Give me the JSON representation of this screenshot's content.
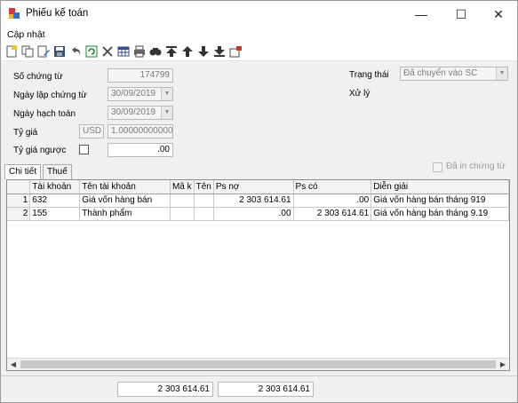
{
  "window": {
    "title": "Phiếu kế toán",
    "minimize": "—",
    "maximize": "☐",
    "close": "✕"
  },
  "menu": {
    "cap_nhat": "Cập nhật"
  },
  "toolbar": {
    "icons": [
      "new-icon",
      "copy-icon",
      "edit-icon",
      "save-icon",
      "undo-icon",
      "refresh-icon",
      "delete-icon",
      "table-icon",
      "print-icon",
      "find-icon",
      "first-icon",
      "prev-icon",
      "next-icon",
      "last-icon",
      "export-icon"
    ]
  },
  "form": {
    "so_chung_tu_label": "Số chứng từ",
    "so_chung_tu": "174799",
    "ngay_lap_label": "Ngày lập chứng từ",
    "ngay_lap": "30/09/2019",
    "ngay_hach_toan_label": "Ngày hạch toán",
    "ngay_hach_toan": "30/09/2019",
    "ty_gia_label": "Tỷ giá",
    "currency": "USD",
    "ty_gia": "1.000000000000",
    "ty_gia_nguoc_label": "Tỷ giá ngược",
    "ty_gia_nguoc": ".00",
    "trang_thai_label": "Trạng thái",
    "trang_thai": "Đã chuyển vào SC",
    "xu_ly_label": "Xử lý",
    "da_in_label": "Đã in chứng từ"
  },
  "tabs": [
    "Chi tiết",
    "Thuế"
  ],
  "grid": {
    "headers": [
      "Tài khoản",
      "Tên tài khoản",
      "Mã k",
      "Tên",
      "Ps nợ",
      "Ps có",
      "Diễn giải"
    ],
    "rows": [
      {
        "n": "1",
        "tk": "632",
        "ten": "Giá vốn hàng bán",
        "ma": "",
        "tenk": "",
        "no": "2 303 614.61",
        "co": ".00",
        "dg": "Giá vốn hàng bán tháng 919"
      },
      {
        "n": "2",
        "tk": "155",
        "ten": "Thành phẩm",
        "ma": "",
        "tenk": "",
        "no": ".00",
        "co": "2 303 614.61",
        "dg": "Giá vốn hàng bán tháng 9.19"
      }
    ]
  },
  "totals": {
    "no": "2 303 614.61",
    "co": "2 303 614.61"
  }
}
